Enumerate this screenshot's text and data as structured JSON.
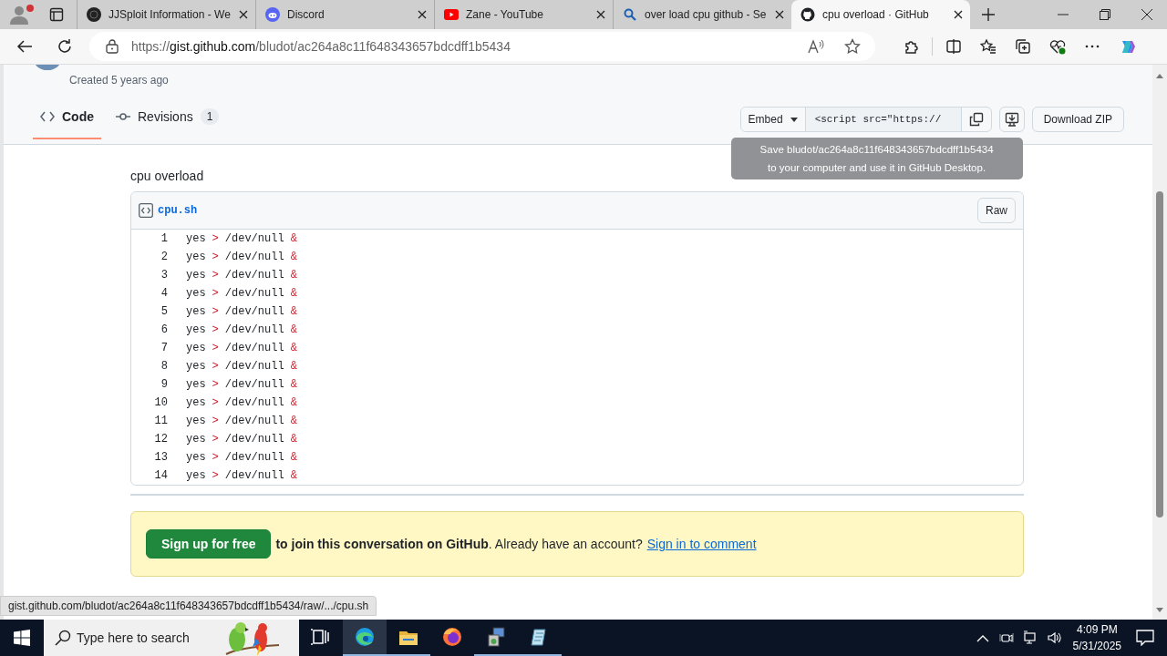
{
  "browser": {
    "tabs": [
      {
        "title": "JJSploit Information - We",
        "kind": "dark",
        "selected": false
      },
      {
        "title": "Discord",
        "kind": "discord",
        "selected": false
      },
      {
        "title": "Zane - YouTube",
        "kind": "youtube",
        "selected": false
      },
      {
        "title": "over load cpu github - Se",
        "kind": "search",
        "selected": false
      },
      {
        "title": "cpu overload · GitHub",
        "kind": "github",
        "selected": true
      }
    ],
    "url": {
      "scheme": "https://",
      "host": "gist.github.com",
      "path": "/bludot/ac264a8c11f648343657bdcdff1b5434"
    }
  },
  "gist": {
    "created": "Created 5 years ago",
    "nav": [
      {
        "label": "Code",
        "kind": "code",
        "selected": true
      },
      {
        "label": "Revisions",
        "kind": "commit",
        "count": "1",
        "selected": false
      }
    ],
    "embed": {
      "label": "Embed",
      "value": "<script src=\"https://"
    },
    "download": "Download ZIP",
    "tooltip": [
      "Save bludot/ac264a8c11f648343657bdcdff1b5434",
      "to your computer and use it in GitHub Desktop."
    ],
    "description": "cpu overload",
    "file": {
      "name": "cpu.sh",
      "raw": "Raw",
      "lines": [
        {
          "number": "1",
          "tokens": [
            {
              "text": "yes",
              "kind": "plain"
            },
            {
              "text": ">",
              "kind": "operator"
            },
            {
              "text": "/dev/null",
              "kind": "plain"
            },
            {
              "text": "&",
              "kind": "operator"
            }
          ]
        },
        {
          "number": "2",
          "tokens": [
            {
              "text": "yes",
              "kind": "plain"
            },
            {
              "text": ">",
              "kind": "operator"
            },
            {
              "text": "/dev/null",
              "kind": "plain"
            },
            {
              "text": "&",
              "kind": "operator"
            }
          ]
        },
        {
          "number": "3",
          "tokens": [
            {
              "text": "yes",
              "kind": "plain"
            },
            {
              "text": ">",
              "kind": "operator"
            },
            {
              "text": "/dev/null",
              "kind": "plain"
            },
            {
              "text": "&",
              "kind": "operator"
            }
          ]
        },
        {
          "number": "4",
          "tokens": [
            {
              "text": "yes",
              "kind": "plain"
            },
            {
              "text": ">",
              "kind": "operator"
            },
            {
              "text": "/dev/null",
              "kind": "plain"
            },
            {
              "text": "&",
              "kind": "operator"
            }
          ]
        },
        {
          "number": "5",
          "tokens": [
            {
              "text": "yes",
              "kind": "plain"
            },
            {
              "text": ">",
              "kind": "operator"
            },
            {
              "text": "/dev/null",
              "kind": "plain"
            },
            {
              "text": "&",
              "kind": "operator"
            }
          ]
        },
        {
          "number": "6",
          "tokens": [
            {
              "text": "yes",
              "kind": "plain"
            },
            {
              "text": ">",
              "kind": "operator"
            },
            {
              "text": "/dev/null",
              "kind": "plain"
            },
            {
              "text": "&",
              "kind": "operator"
            }
          ]
        },
        {
          "number": "7",
          "tokens": [
            {
              "text": "yes",
              "kind": "plain"
            },
            {
              "text": ">",
              "kind": "operator"
            },
            {
              "text": "/dev/null",
              "kind": "plain"
            },
            {
              "text": "&",
              "kind": "operator"
            }
          ]
        },
        {
          "number": "8",
          "tokens": [
            {
              "text": "yes",
              "kind": "plain"
            },
            {
              "text": ">",
              "kind": "operator"
            },
            {
              "text": "/dev/null",
              "kind": "plain"
            },
            {
              "text": "&",
              "kind": "operator"
            }
          ]
        },
        {
          "number": "9",
          "tokens": [
            {
              "text": "yes",
              "kind": "plain"
            },
            {
              "text": ">",
              "kind": "operator"
            },
            {
              "text": "/dev/null",
              "kind": "plain"
            },
            {
              "text": "&",
              "kind": "operator"
            }
          ]
        },
        {
          "number": "10",
          "tokens": [
            {
              "text": "yes",
              "kind": "plain"
            },
            {
              "text": ">",
              "kind": "operator"
            },
            {
              "text": "/dev/null",
              "kind": "plain"
            },
            {
              "text": "&",
              "kind": "operator"
            }
          ]
        },
        {
          "number": "11",
          "tokens": [
            {
              "text": "yes",
              "kind": "plain"
            },
            {
              "text": ">",
              "kind": "operator"
            },
            {
              "text": "/dev/null",
              "kind": "plain"
            },
            {
              "text": "&",
              "kind": "operator"
            }
          ]
        },
        {
          "number": "12",
          "tokens": [
            {
              "text": "yes",
              "kind": "plain"
            },
            {
              "text": ">",
              "kind": "operator"
            },
            {
              "text": "/dev/null",
              "kind": "plain"
            },
            {
              "text": "&",
              "kind": "operator"
            }
          ]
        },
        {
          "number": "13",
          "tokens": [
            {
              "text": "yes",
              "kind": "plain"
            },
            {
              "text": ">",
              "kind": "operator"
            },
            {
              "text": "/dev/null",
              "kind": "plain"
            },
            {
              "text": "&",
              "kind": "operator"
            }
          ]
        },
        {
          "number": "14",
          "tokens": [
            {
              "text": "yes",
              "kind": "plain"
            },
            {
              "text": ">",
              "kind": "operator"
            },
            {
              "text": "/dev/null",
              "kind": "plain"
            },
            {
              "text": "&",
              "kind": "operator"
            }
          ]
        }
      ]
    },
    "banner": {
      "button": "Sign up for free",
      "text": "**to join this conversation on GitHub**. Already have an account?",
      "link": "Sign in to comment"
    }
  },
  "status_url": "gist.github.com/bludot/ac264a8c11f648343657bdcdff1b5434/raw/.../cpu.sh",
  "taskbar": {
    "search_placeholder": "Type here to search",
    "apps": [
      {
        "kind": "taskview",
        "active": false,
        "running": false
      },
      {
        "kind": "edge",
        "active": true,
        "running": true
      },
      {
        "kind": "folder",
        "active": false,
        "running": true
      },
      {
        "kind": "firefox",
        "active": false,
        "running": false
      },
      {
        "kind": "installer",
        "active": false,
        "running": true
      },
      {
        "kind": "notepad",
        "active": false,
        "running": true
      }
    ],
    "time": "4:09 PM",
    "date": "5/31/2025"
  }
}
